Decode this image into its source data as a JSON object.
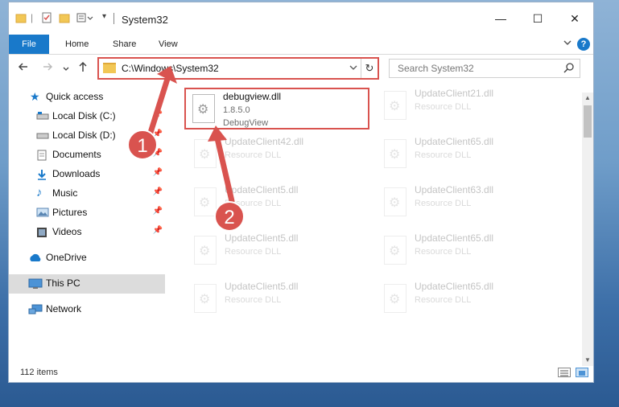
{
  "window": {
    "title": "System32",
    "controls": {
      "minimize": "—",
      "maximize": "☐",
      "close": "✕"
    }
  },
  "ribbon": {
    "tabs": [
      "File",
      "Home",
      "Share",
      "View"
    ],
    "expand_icon": "chevron-down",
    "help": "?"
  },
  "address_bar": {
    "path": "C:\\Windows\\System32",
    "search_placeholder": "Search System32"
  },
  "sidebar": {
    "items": [
      {
        "label": "Quick access",
        "icon": "star",
        "pinned": false
      },
      {
        "label": "Local Disk (C:)",
        "icon": "drive",
        "pinned": true
      },
      {
        "label": "Local Disk (D:)",
        "icon": "drive",
        "pinned": true
      },
      {
        "label": "Documents",
        "icon": "documents",
        "pinned": true
      },
      {
        "label": "Downloads",
        "icon": "downloads",
        "pinned": true
      },
      {
        "label": "Music",
        "icon": "music",
        "pinned": true
      },
      {
        "label": "Pictures",
        "icon": "pictures",
        "pinned": true
      },
      {
        "label": "Videos",
        "icon": "videos",
        "pinned": true
      },
      {
        "label": "OneDrive",
        "icon": "cloud",
        "pinned": false
      },
      {
        "label": "This PC",
        "icon": "computer",
        "pinned": false,
        "selected": true
      },
      {
        "label": "Network",
        "icon": "network",
        "pinned": false
      }
    ]
  },
  "files": {
    "highlighted": {
      "name": "debugview.dll",
      "version": "1.8.5.0",
      "description": "DebugView"
    },
    "faded": [
      {
        "name": "UpdateClient21.dll",
        "type": "Resource DLL"
      },
      {
        "name": "UpdateClient42.dll",
        "type": "Resource DLL"
      },
      {
        "name": "UpdateClient65.dll",
        "type": "Resource DLL"
      },
      {
        "name": "UpdateClient5.dll",
        "type": "Resource DLL"
      },
      {
        "name": "UpdateClient63.dll",
        "type": "Resource DLL"
      },
      {
        "name": "UpdateClient5.dll",
        "type": "Resource DLL"
      },
      {
        "name": "UpdateClient65.dll",
        "type": "Resource DLL"
      },
      {
        "name": "UpdateClient5.dll",
        "type": "Resource DLL"
      },
      {
        "name": "UpdateClient65.dll",
        "type": "Resource DLL"
      }
    ]
  },
  "status": {
    "item_count": "112 items"
  },
  "annotations": {
    "step1": "1",
    "step2": "2",
    "color": "#d9534f"
  }
}
